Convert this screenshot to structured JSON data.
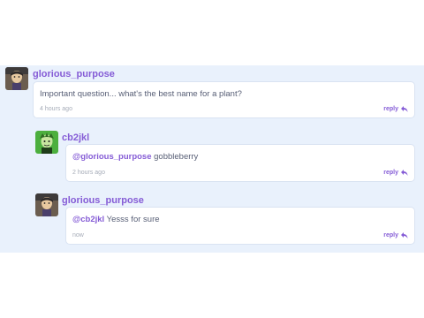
{
  "comments": [
    {
      "username": "glorious_purpose",
      "mention": "",
      "text": "Important question... what's the best name for a plant?",
      "time": "4 hours ago",
      "reply_label": "reply",
      "avatar_icon": "user-avatar-icon"
    },
    {
      "username": "cb2jkl",
      "mention": "@glorious_purpose",
      "text": " gobbleberry",
      "time": "2 hours ago",
      "reply_label": "reply",
      "avatar_icon": "user-avatar-icon"
    },
    {
      "username": "glorious_purpose",
      "mention": "@cb2jkl",
      "text": " Yesss for sure",
      "time": "now",
      "reply_label": "reply",
      "avatar_icon": "user-avatar-icon"
    }
  ],
  "colors": {
    "accent": "#855cd6",
    "thread_background": "#e9f1fc",
    "text": "#575e75",
    "timestamp": "#a6acb8"
  }
}
